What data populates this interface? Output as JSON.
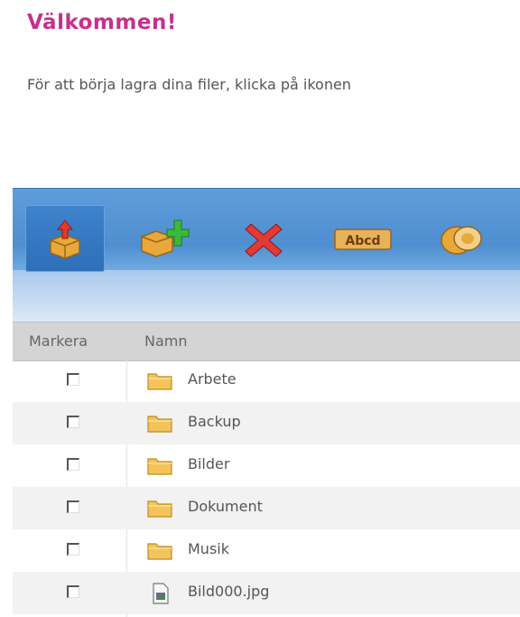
{
  "page": {
    "welcome_title": "Välkommen!",
    "intro_text": "För att börja lagra dina filer, klicka på ikonen"
  },
  "toolbar": {
    "buttons": [
      {
        "name": "upload",
        "icon": "upload-box-icon",
        "active": true
      },
      {
        "name": "new-folder",
        "icon": "add-folder-icon",
        "active": false
      },
      {
        "name": "delete",
        "icon": "delete-x-icon",
        "active": false
      },
      {
        "name": "rename",
        "icon": "rename-abcd-icon",
        "active": false
      },
      {
        "name": "move",
        "icon": "move-icon",
        "active": false
      }
    ],
    "colors": {
      "bar": "#4f8ed0",
      "band": "#c4dbf2",
      "active": "#2d6fb9"
    }
  },
  "table": {
    "headers": {
      "select": "Markera",
      "name": "Namn"
    },
    "rows": [
      {
        "type": "folder",
        "name": "Arbete"
      },
      {
        "type": "folder",
        "name": "Backup"
      },
      {
        "type": "folder",
        "name": "Bilder"
      },
      {
        "type": "folder",
        "name": "Dokument"
      },
      {
        "type": "folder",
        "name": "Musik"
      },
      {
        "type": "file",
        "name": "Bild000.jpg"
      }
    ]
  },
  "colors": {
    "title": "#c8308c",
    "header_bg": "#d4d4d4",
    "row_alt": "#f2f2f2"
  }
}
